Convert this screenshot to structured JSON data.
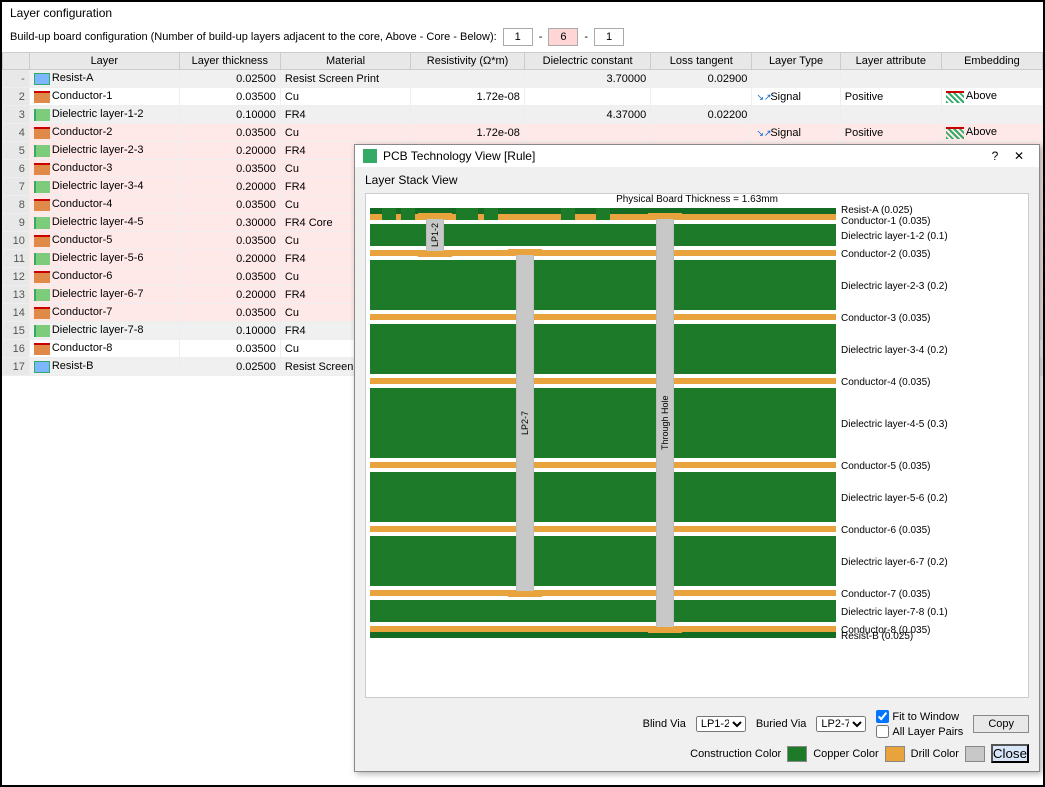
{
  "panel": {
    "title": "Layer configuration"
  },
  "config": {
    "label": "Build-up board configuration (Number of build-up layers adjacent to the core, Above - Core - Below):",
    "above": "1",
    "core": "6",
    "below": "1"
  },
  "headers": {
    "layer": "Layer",
    "thickness": "Layer thickness",
    "material": "Material",
    "resistivity": "Resistivity (Ω*m)",
    "dielectric": "Dielectric constant",
    "loss": "Loss tangent",
    "type": "Layer Type",
    "attribute": "Layer attribute",
    "embedding": "Embedding"
  },
  "rows": [
    {
      "n": "-",
      "name": "Resist-A",
      "thk": "0.02500",
      "mat": "Resist Screen Print",
      "res": "",
      "dk": "3.70000",
      "lt": "0.02900",
      "lty": "",
      "attr": "",
      "emb": "",
      "ico": "res",
      "cls": "alt"
    },
    {
      "n": "2",
      "name": "Conductor-1",
      "thk": "0.03500",
      "mat": "Cu",
      "res": "1.72e-08",
      "dk": "",
      "lt": "",
      "lty": "Signal",
      "attr": "Positive",
      "emb": "Above",
      "ico": "cond",
      "cls": ""
    },
    {
      "n": "3",
      "name": "Dielectric layer-1-2",
      "thk": "0.10000",
      "mat": "FR4",
      "res": "",
      "dk": "4.37000",
      "lt": "0.02200",
      "lty": "",
      "attr": "",
      "emb": "",
      "ico": "diel",
      "cls": "alt"
    },
    {
      "n": "4",
      "name": "Conductor-2",
      "thk": "0.03500",
      "mat": "Cu",
      "res": "1.72e-08",
      "dk": "",
      "lt": "",
      "lty": "Signal",
      "attr": "Positive",
      "emb": "Above",
      "ico": "cond",
      "cls": "pink"
    },
    {
      "n": "5",
      "name": "Dielectric layer-2-3",
      "thk": "0.20000",
      "mat": "FR4",
      "res": "",
      "dk": "",
      "lt": "",
      "lty": "",
      "attr": "",
      "emb": "",
      "ico": "diel",
      "cls": "pink"
    },
    {
      "n": "6",
      "name": "Conductor-3",
      "thk": "0.03500",
      "mat": "Cu",
      "res": "",
      "dk": "",
      "lt": "",
      "lty": "",
      "attr": "",
      "emb": "",
      "ico": "cond",
      "cls": "pink"
    },
    {
      "n": "7",
      "name": "Dielectric layer-3-4",
      "thk": "0.20000",
      "mat": "FR4",
      "res": "",
      "dk": "",
      "lt": "",
      "lty": "",
      "attr": "",
      "emb": "",
      "ico": "diel",
      "cls": "pink"
    },
    {
      "n": "8",
      "name": "Conductor-4",
      "thk": "0.03500",
      "mat": "Cu",
      "res": "",
      "dk": "",
      "lt": "",
      "lty": "",
      "attr": "",
      "emb": "",
      "ico": "cond",
      "cls": "pink"
    },
    {
      "n": "9",
      "name": "Dielectric layer-4-5",
      "thk": "0.30000",
      "mat": "FR4 Core",
      "res": "",
      "dk": "",
      "lt": "",
      "lty": "",
      "attr": "",
      "emb": "",
      "ico": "diel",
      "cls": "pink"
    },
    {
      "n": "10",
      "name": "Conductor-5",
      "thk": "0.03500",
      "mat": "Cu",
      "res": "",
      "dk": "",
      "lt": "",
      "lty": "",
      "attr": "",
      "emb": "",
      "ico": "cond",
      "cls": "pink"
    },
    {
      "n": "11",
      "name": "Dielectric layer-5-6",
      "thk": "0.20000",
      "mat": "FR4",
      "res": "",
      "dk": "",
      "lt": "",
      "lty": "",
      "attr": "",
      "emb": "",
      "ico": "diel",
      "cls": "pink"
    },
    {
      "n": "12",
      "name": "Conductor-6",
      "thk": "0.03500",
      "mat": "Cu",
      "res": "",
      "dk": "",
      "lt": "",
      "lty": "",
      "attr": "",
      "emb": "",
      "ico": "cond",
      "cls": "pink"
    },
    {
      "n": "13",
      "name": "Dielectric layer-6-7",
      "thk": "0.20000",
      "mat": "FR4",
      "res": "",
      "dk": "",
      "lt": "",
      "lty": "",
      "attr": "",
      "emb": "",
      "ico": "diel",
      "cls": "pink"
    },
    {
      "n": "14",
      "name": "Conductor-7",
      "thk": "0.03500",
      "mat": "Cu",
      "res": "",
      "dk": "",
      "lt": "",
      "lty": "",
      "attr": "",
      "emb": "",
      "ico": "cond",
      "cls": "pink"
    },
    {
      "n": "15",
      "name": "Dielectric layer-7-8",
      "thk": "0.10000",
      "mat": "FR4",
      "res": "",
      "dk": "",
      "lt": "",
      "lty": "",
      "attr": "",
      "emb": "",
      "ico": "diel",
      "cls": "alt"
    },
    {
      "n": "16",
      "name": "Conductor-8",
      "thk": "0.03500",
      "mat": "Cu",
      "res": "",
      "dk": "",
      "lt": "",
      "lty": "",
      "attr": "",
      "emb": "",
      "ico": "cond",
      "cls": ""
    },
    {
      "n": "17",
      "name": "Resist-B",
      "thk": "0.02500",
      "mat": "Resist Screen Print",
      "res": "",
      "dk": "",
      "lt": "",
      "lty": "",
      "attr": "",
      "emb": "",
      "ico": "res",
      "cls": "alt"
    }
  ],
  "dialog": {
    "title": "PCB Technology View [Rule]",
    "stack_title": "Layer Stack View",
    "phys": "Physical Board Thickness = 1.63mm",
    "labels": [
      "Resist-A (0.025)",
      "Conductor-1 (0.035)",
      "Dielectric layer-1-2 (0.1)",
      "Conductor-2 (0.035)",
      "Dielectric layer-2-3 (0.2)",
      "Conductor-3 (0.035)",
      "Dielectric layer-3-4 (0.2)",
      "Conductor-4 (0.035)",
      "Dielectric layer-4-5 (0.3)",
      "Conductor-5 (0.035)",
      "Dielectric layer-5-6 (0.2)",
      "Conductor-6 (0.035)",
      "Dielectric layer-6-7 (0.2)",
      "Conductor-7 (0.035)",
      "Dielectric layer-7-8 (0.1)",
      "Conductor-8 (0.035)",
      "Resist-B (0.025)"
    ],
    "via1": "LP1-2",
    "via2": "LP2-7",
    "via3": "Through Hole",
    "blind_lbl": "Blind Via",
    "blind_val": "LP1-2",
    "buried_lbl": "Buried Via",
    "buried_val": "LP2-7",
    "fit": "Fit to Window",
    "all": "All Layer Pairs",
    "copy": "Copy",
    "close": "Close",
    "legend": {
      "construction": "Construction Color",
      "copper": "Copper Color",
      "drill": "Drill Color"
    },
    "colors": {
      "construction": "#1c7a29",
      "copper": "#e8a33c",
      "drill": "#c8c8c8"
    }
  }
}
